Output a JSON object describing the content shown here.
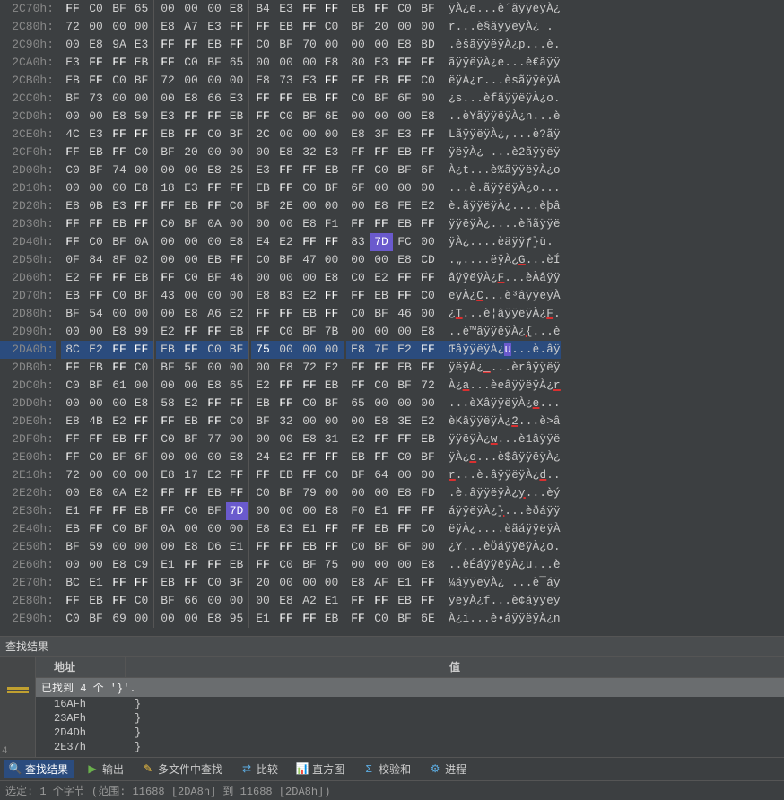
{
  "hex_rows": [
    {
      "addr": "2C70h:",
      "bytes": [
        "FF",
        "C0",
        "BF",
        "65",
        "00",
        "00",
        "00",
        "E8",
        "B4",
        "E3",
        "FF",
        "FF",
        "EB",
        "FF",
        "C0",
        "BF"
      ],
      "ascii": "ÿÀ¿e...è´ãÿÿëÿÀ¿"
    },
    {
      "addr": "2C80h:",
      "bytes": [
        "72",
        "00",
        "00",
        "00",
        "E8",
        "A7",
        "E3",
        "FF",
        "FF",
        "EB",
        "FF",
        "C0",
        "BF",
        "20",
        "00",
        "00"
      ],
      "ascii": "r...è§ãÿÿëÿÀ¿ ."
    },
    {
      "addr": "2C90h:",
      "bytes": [
        "00",
        "E8",
        "9A",
        "E3",
        "FF",
        "FF",
        "EB",
        "FF",
        "C0",
        "BF",
        "70",
        "00",
        "00",
        "00",
        "E8",
        "8D"
      ],
      "ascii": ".èšãÿÿëÿÀ¿p...è."
    },
    {
      "addr": "2CA0h:",
      "bytes": [
        "E3",
        "FF",
        "FF",
        "EB",
        "FF",
        "C0",
        "BF",
        "65",
        "00",
        "00",
        "00",
        "E8",
        "80",
        "E3",
        "FF",
        "FF"
      ],
      "ascii": "ãÿÿëÿÀ¿e...è€ãÿÿ"
    },
    {
      "addr": "2CB0h:",
      "bytes": [
        "EB",
        "FF",
        "C0",
        "BF",
        "72",
        "00",
        "00",
        "00",
        "E8",
        "73",
        "E3",
        "FF",
        "FF",
        "EB",
        "FF",
        "C0"
      ],
      "ascii": "ëÿÀ¿r...èsãÿÿëÿÀ"
    },
    {
      "addr": "2CC0h:",
      "bytes": [
        "BF",
        "73",
        "00",
        "00",
        "00",
        "E8",
        "66",
        "E3",
        "FF",
        "FF",
        "EB",
        "FF",
        "C0",
        "BF",
        "6F",
        "00"
      ],
      "ascii": "¿s...èfãÿÿëÿÀ¿o."
    },
    {
      "addr": "2CD0h:",
      "bytes": [
        "00",
        "00",
        "E8",
        "59",
        "E3",
        "FF",
        "FF",
        "EB",
        "FF",
        "C0",
        "BF",
        "6E",
        "00",
        "00",
        "00",
        "E8"
      ],
      "ascii": "..èYãÿÿëÿÀ¿n...è"
    },
    {
      "addr": "2CE0h:",
      "bytes": [
        "4C",
        "E3",
        "FF",
        "FF",
        "EB",
        "FF",
        "C0",
        "BF",
        "2C",
        "00",
        "00",
        "00",
        "E8",
        "3F",
        "E3",
        "FF"
      ],
      "ascii": "LãÿÿëÿÀ¿,...è?ãÿ"
    },
    {
      "addr": "2CF0h:",
      "bytes": [
        "FF",
        "EB",
        "FF",
        "C0",
        "BF",
        "20",
        "00",
        "00",
        "00",
        "E8",
        "32",
        "E3",
        "FF",
        "FF",
        "EB",
        "FF"
      ],
      "ascii": "ÿëÿÀ¿ ...è2ãÿÿëÿ"
    },
    {
      "addr": "2D00h:",
      "bytes": [
        "C0",
        "BF",
        "74",
        "00",
        "00",
        "00",
        "E8",
        "25",
        "E3",
        "FF",
        "FF",
        "EB",
        "FF",
        "C0",
        "BF",
        "6F"
      ],
      "ascii": "À¿t...è%ãÿÿëÿÀ¿o"
    },
    {
      "addr": "2D10h:",
      "bytes": [
        "00",
        "00",
        "00",
        "E8",
        "18",
        "E3",
        "FF",
        "FF",
        "EB",
        "FF",
        "C0",
        "BF",
        "6F",
        "00",
        "00",
        "00"
      ],
      "ascii": "...è.ãÿÿëÿÀ¿o..."
    },
    {
      "addr": "2D20h:",
      "bytes": [
        "E8",
        "0B",
        "E3",
        "FF",
        "FF",
        "EB",
        "FF",
        "C0",
        "BF",
        "2E",
        "00",
        "00",
        "00",
        "E8",
        "FE",
        "E2"
      ],
      "ascii": "è.ãÿÿëÿÀ¿....èþâ"
    },
    {
      "addr": "2D30h:",
      "bytes": [
        "FF",
        "FF",
        "EB",
        "FF",
        "C0",
        "BF",
        "0A",
        "00",
        "00",
        "00",
        "E8",
        "F1",
        "FF",
        "FF",
        "EB",
        "FF"
      ],
      "ascii": "ÿÿëÿÀ¿....èñãÿÿë"
    },
    {
      "addr": "2D40h:",
      "bytes": [
        "FF",
        "C0",
        "BF",
        "0A",
        "00",
        "00",
        "00",
        "E8",
        "E4",
        "E2",
        "FF",
        "FF",
        "83",
        "7D",
        "FC",
        "00"
      ],
      "ascii": "ÿÀ¿....èäÿÿƒ}ü.",
      "purple": [
        13
      ]
    },
    {
      "addr": "2D50h:",
      "bytes": [
        "0F",
        "84",
        "8F",
        "02",
        "00",
        "00",
        "EB",
        "FF",
        "C0",
        "BF",
        "47",
        "00",
        "00",
        "00",
        "E8",
        "CD"
      ],
      "ascii": ".„....ëÿÀ¿G...èÍ",
      "ul": [
        "G"
      ]
    },
    {
      "addr": "2D60h:",
      "bytes": [
        "E2",
        "FF",
        "FF",
        "EB",
        "FF",
        "C0",
        "BF",
        "46",
        "00",
        "00",
        "00",
        "E8",
        "C0",
        "E2",
        "FF",
        "FF"
      ],
      "ascii": "âÿÿëÿÀ¿F...èÀâÿÿ",
      "ul": [
        "F"
      ]
    },
    {
      "addr": "2D70h:",
      "bytes": [
        "EB",
        "FF",
        "C0",
        "BF",
        "43",
        "00",
        "00",
        "00",
        "E8",
        "B3",
        "E2",
        "FF",
        "FF",
        "EB",
        "FF",
        "C0"
      ],
      "ascii": "ëÿÀ¿C...è³âÿÿëÿÀ",
      "ul": [
        "C"
      ]
    },
    {
      "addr": "2D80h:",
      "bytes": [
        "BF",
        "54",
        "00",
        "00",
        "00",
        "E8",
        "A6",
        "E2",
        "FF",
        "FF",
        "EB",
        "FF",
        "C0",
        "BF",
        "46",
        "00"
      ],
      "ascii": "¿T...è¦âÿÿëÿÀ¿F.",
      "ul": [
        "T",
        "F"
      ]
    },
    {
      "addr": "2D90h:",
      "bytes": [
        "00",
        "00",
        "E8",
        "99",
        "E2",
        "FF",
        "FF",
        "EB",
        "FF",
        "C0",
        "BF",
        "7B",
        "00",
        "00",
        "00",
        "E8"
      ],
      "ascii": "..è™âÿÿëÿÀ¿{...è",
      "ul": [
        "{"
      ]
    },
    {
      "addr": "2DA0h:",
      "bytes": [
        "8C",
        "E2",
        "FF",
        "FF",
        "EB",
        "FF",
        "C0",
        "BF",
        "75",
        "00",
        "00",
        "00",
        "E8",
        "7F",
        "E2",
        "FF"
      ],
      "ascii": "ŒâÿÿëÿÀ¿u...è.âÿ",
      "blue": true,
      "purple": [
        8
      ],
      "hl_ascii": "u"
    },
    {
      "addr": "2DB0h:",
      "bytes": [
        "FF",
        "EB",
        "FF",
        "C0",
        "BF",
        "5F",
        "00",
        "00",
        "00",
        "E8",
        "72",
        "E2",
        "FF",
        "FF",
        "EB",
        "FF"
      ],
      "ascii": "ÿëÿÀ¿_...èrâÿÿëÿ",
      "ul": [
        "_"
      ]
    },
    {
      "addr": "2DC0h:",
      "bytes": [
        "C0",
        "BF",
        "61",
        "00",
        "00",
        "00",
        "E8",
        "65",
        "E2",
        "FF",
        "FF",
        "EB",
        "FF",
        "C0",
        "BF",
        "72"
      ],
      "ascii": "À¿a...èeâÿÿëÿÀ¿r",
      "ul": [
        "a",
        "r"
      ]
    },
    {
      "addr": "2DD0h:",
      "bytes": [
        "00",
        "00",
        "00",
        "E8",
        "58",
        "E2",
        "FF",
        "FF",
        "EB",
        "FF",
        "C0",
        "BF",
        "65",
        "00",
        "00",
        "00"
      ],
      "ascii": "...èXâÿÿëÿÀ¿e...",
      "ul": [
        "e"
      ]
    },
    {
      "addr": "2DE0h:",
      "bytes": [
        "E8",
        "4B",
        "E2",
        "FF",
        "FF",
        "EB",
        "FF",
        "C0",
        "BF",
        "32",
        "00",
        "00",
        "00",
        "E8",
        "3E",
        "E2"
      ],
      "ascii": "èKâÿÿëÿÀ¿2...è>â",
      "ul": [
        "2"
      ]
    },
    {
      "addr": "2DF0h:",
      "bytes": [
        "FF",
        "FF",
        "EB",
        "FF",
        "C0",
        "BF",
        "77",
        "00",
        "00",
        "00",
        "E8",
        "31",
        "E2",
        "FF",
        "FF",
        "EB"
      ],
      "ascii": "ÿÿëÿÀ¿w...è1âÿÿë",
      "ul": [
        "w"
      ]
    },
    {
      "addr": "2E00h:",
      "bytes": [
        "FF",
        "C0",
        "BF",
        "6F",
        "00",
        "00",
        "00",
        "E8",
        "24",
        "E2",
        "FF",
        "FF",
        "EB",
        "FF",
        "C0",
        "BF"
      ],
      "ascii": "ÿÀ¿o...è$âÿÿëÿÀ¿",
      "ul": [
        "o"
      ]
    },
    {
      "addr": "2E10h:",
      "bytes": [
        "72",
        "00",
        "00",
        "00",
        "E8",
        "17",
        "E2",
        "FF",
        "FF",
        "EB",
        "FF",
        "C0",
        "BF",
        "64",
        "00",
        "00"
      ],
      "ascii": "r...è.âÿÿëÿÀ¿d..",
      "ul": [
        "r",
        "d"
      ]
    },
    {
      "addr": "2E20h:",
      "bytes": [
        "00",
        "E8",
        "0A",
        "E2",
        "FF",
        "FF",
        "EB",
        "FF",
        "C0",
        "BF",
        "79",
        "00",
        "00",
        "00",
        "E8",
        "FD"
      ],
      "ascii": ".è.âÿÿëÿÀ¿y...èý",
      "ul": [
        "y"
      ]
    },
    {
      "addr": "2E30h:",
      "bytes": [
        "E1",
        "FF",
        "FF",
        "EB",
        "FF",
        "C0",
        "BF",
        "7D",
        "00",
        "00",
        "00",
        "E8",
        "F0",
        "E1",
        "FF",
        "FF"
      ],
      "ascii": "áÿÿëÿÀ¿}...èðáÿÿ",
      "purple": [
        7
      ],
      "ul": [
        "}"
      ]
    },
    {
      "addr": "2E40h:",
      "bytes": [
        "EB",
        "FF",
        "C0",
        "BF",
        "0A",
        "00",
        "00",
        "00",
        "E8",
        "E3",
        "E1",
        "FF",
        "FF",
        "EB",
        "FF",
        "C0"
      ],
      "ascii": "ëÿÀ¿....èãáÿÿëÿÀ"
    },
    {
      "addr": "2E50h:",
      "bytes": [
        "BF",
        "59",
        "00",
        "00",
        "00",
        "E8",
        "D6",
        "E1",
        "FF",
        "FF",
        "EB",
        "FF",
        "C0",
        "BF",
        "6F",
        "00"
      ],
      "ascii": "¿Y...èÖáÿÿëÿÀ¿o."
    },
    {
      "addr": "2E60h:",
      "bytes": [
        "00",
        "00",
        "E8",
        "C9",
        "E1",
        "FF",
        "FF",
        "EB",
        "FF",
        "C0",
        "BF",
        "75",
        "00",
        "00",
        "00",
        "E8"
      ],
      "ascii": "..èÉáÿÿëÿÀ¿u...è"
    },
    {
      "addr": "2E70h:",
      "bytes": [
        "BC",
        "E1",
        "FF",
        "FF",
        "EB",
        "FF",
        "C0",
        "BF",
        "20",
        "00",
        "00",
        "00",
        "E8",
        "AF",
        "E1",
        "FF"
      ],
      "ascii": "¼áÿÿëÿÀ¿ ...è¯áÿ"
    },
    {
      "addr": "2E80h:",
      "bytes": [
        "FF",
        "EB",
        "FF",
        "C0",
        "BF",
        "66",
        "00",
        "00",
        "00",
        "E8",
        "A2",
        "E1",
        "FF",
        "FF",
        "EB",
        "FF"
      ],
      "ascii": "ÿëÿÀ¿f...è¢áÿÿëÿ"
    },
    {
      "addr": "2E90h:",
      "bytes": [
        "C0",
        "BF",
        "69",
        "00",
        "00",
        "00",
        "E8",
        "95",
        "E1",
        "FF",
        "FF",
        "EB",
        "FF",
        "C0",
        "BF",
        "6E"
      ],
      "ascii": "À¿i...è•áÿÿëÿÀ¿n"
    }
  ],
  "search": {
    "title": "查找结果",
    "col_addr": "地址",
    "col_val": "值",
    "found_msg": "已找到 4 个 '}'.",
    "rows": [
      {
        "addr": "16AFh",
        "val": "}"
      },
      {
        "addr": "23AFh",
        "val": "}"
      },
      {
        "addr": "2D4Dh",
        "val": "}"
      },
      {
        "addr": "2E37h",
        "val": "}"
      }
    ],
    "gutter_num": "4"
  },
  "tabs": {
    "search_results": "查找结果",
    "output": "输出",
    "find_in_files": "多文件中查找",
    "compare": "比较",
    "histogram": "直方图",
    "checksum": "校验和",
    "process": "进程"
  },
  "status": "选定: 1 个字节 (范围: 11688 [2DA8h] 到 11688 [2DA8h])"
}
